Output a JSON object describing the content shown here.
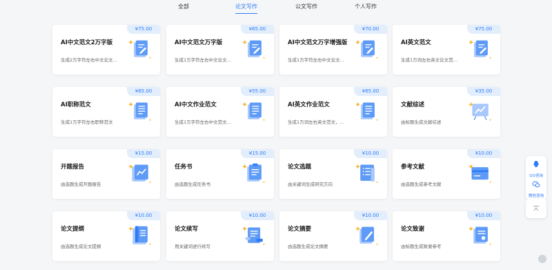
{
  "tabs": [
    {
      "label": "全部",
      "active": false
    },
    {
      "label": "论文写作",
      "active": true
    },
    {
      "label": "公文写作",
      "active": false
    },
    {
      "label": "个人写作",
      "active": false
    }
  ],
  "cards": [
    {
      "price": "¥75.00",
      "title": "AI中文范文2万字版",
      "desc": "生成2万字符左右中文论文…",
      "icon": "document-pencil-icon"
    },
    {
      "price": "¥65.00",
      "title": "AI中文范文万字版",
      "desc": "生成1万字符左右中文论文…",
      "icon": "document-pencil-icon"
    },
    {
      "price": "¥70.00",
      "title": "AI中文范文万字增强版",
      "desc": "生成1万字符左右中文论文…",
      "icon": "document-pencil-icon"
    },
    {
      "price": "¥75.00",
      "title": "AI英文范文",
      "desc": "生成1万词左右英文论文范…",
      "icon": "document-pencil-icon"
    },
    {
      "price": "¥65.00",
      "title": "AI职称范文",
      "desc": "生成1万字符左右职称范文",
      "icon": "document-lines-icon"
    },
    {
      "price": "¥55.00",
      "title": "AI中文作业范文",
      "desc": "生成1万字符左右中文范文…",
      "icon": "document-lines-icon"
    },
    {
      "price": "¥65.00",
      "title": "AI英文作业范文",
      "desc": "生成1万词左右英文范文，…",
      "icon": "document-lines-icon"
    },
    {
      "price": "¥35.00",
      "title": "文献综述",
      "desc": "由标题生成文献综述",
      "icon": "chart-board-icon"
    },
    {
      "price": "¥15.00",
      "title": "开题报告",
      "desc": "由选题生成开题报告",
      "icon": "report-chart-icon"
    },
    {
      "price": "¥15.00",
      "title": "任务书",
      "desc": "由选题生成任务书",
      "icon": "task-document-icon"
    },
    {
      "price": "¥10.00",
      "title": "论文选题",
      "desc": "由关键词生成研究方向",
      "icon": "list-document-icon"
    },
    {
      "price": "¥10.00",
      "title": "参考文献",
      "desc": "由选题生成参考文献",
      "icon": "card-icon"
    },
    {
      "price": "¥10.00",
      "title": "论文提纲",
      "desc": "由选题生成论文提纲",
      "icon": "outline-document-icon"
    },
    {
      "price": "¥10.00",
      "title": "论文续写",
      "desc": "用关键词进行续写",
      "icon": "continue-write-icon"
    },
    {
      "price": "¥10.00",
      "title": "论文摘要",
      "desc": "由选题生成论文摘要",
      "icon": "abstract-pencil-icon"
    },
    {
      "price": "¥10.00",
      "title": "论文致谢",
      "desc": "由标题生成致谢参考",
      "icon": "thanks-document-icon"
    }
  ],
  "sidebar": {
    "qq_label": "QQ咨询",
    "wechat_label": "微信咨询",
    "top_icon": "back-to-top-icon"
  },
  "colors": {
    "accent": "#2f7cf6",
    "price_bg": "#e3eefd",
    "card_bg": "#ffffff",
    "page_bg": "#f5f6f8",
    "sparkle": "#f7b733"
  }
}
